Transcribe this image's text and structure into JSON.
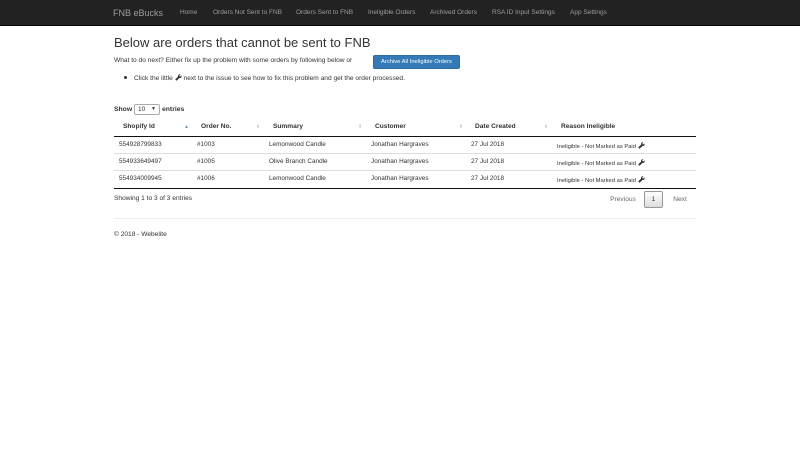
{
  "navbar": {
    "brand": "FNB eBucks",
    "links": [
      "Home",
      "Orders Not Sent to FNB",
      "Orders Sent to FNB",
      "Ineligible Orders",
      "Archived Orders",
      "RSA ID Input Settings",
      "App Settings"
    ]
  },
  "page": {
    "title": "Below are orders that cannot be sent to FNB",
    "intro": "What to do next? Either fix up the problem with some orders by following below or",
    "archive_button": "Archive All Ineligible Orders",
    "hint_before": "Click the little",
    "hint_after": "next to the issue to see how to fix this problem and get the order processed."
  },
  "table_controls": {
    "show_label": "Show",
    "page_length": "10",
    "entries_label": "entries"
  },
  "table": {
    "columns": [
      "Shopify Id",
      "Order No.",
      "Summary",
      "Customer",
      "Date Created",
      "Reason Ineligible"
    ],
    "rows": [
      [
        "554928799833",
        "#1003",
        "Lemonwood Candle",
        "Jonathan Hargraves",
        "27 Jul 2018",
        "Ineligible - Not Marked as Paid"
      ],
      [
        "554933649497",
        "#1005",
        "Olive Branch Candle",
        "Jonathan Hargraves",
        "27 Jul 2018",
        "Ineligible - Not Marked as Paid"
      ],
      [
        "554934009945",
        "#1006",
        "Lemonwood Candle",
        "Jonathan Hargraves",
        "27 Jul 2018",
        "Ineligible - Not Marked as Paid"
      ]
    ]
  },
  "pagination": {
    "info": "Showing 1 to 3 of 3 entries",
    "previous": "Previous",
    "current": "1",
    "next": "Next"
  },
  "footer": {
    "text": "© 2018 - Webelite"
  },
  "icons": {
    "fix": "wrench-icon",
    "sort_active": "sort-up-icon",
    "sort_inactive": "sort-both-icon",
    "select_caret": "caret-down-icon"
  },
  "colors": {
    "navbar": "#222222",
    "nav_text": "#9d9d9d",
    "primary_button": "#337ab7"
  }
}
